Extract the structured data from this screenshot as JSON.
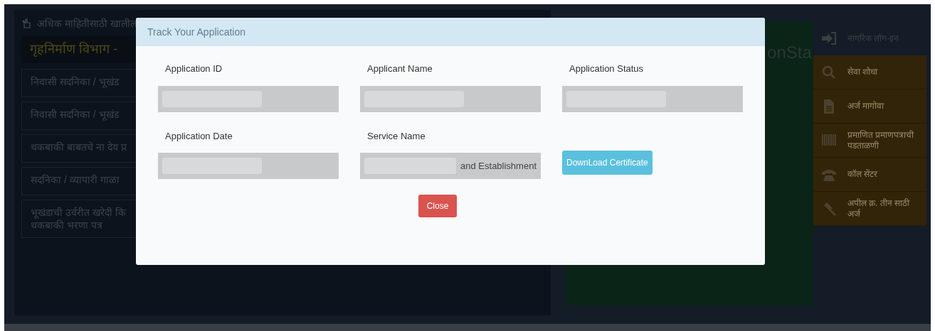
{
  "background": {
    "notice": "अधिक माहितीसाठी खालील",
    "department_heading": "गृहनिर्माण विभाग -",
    "services": [
      "निवासी सदनिका / भूखंड",
      "निवासी सदनिका / भूखंड",
      "थकबाकी बाबतचे ना देय प्र",
      "सदनिका / व्यापारी गाळा",
      "भूखंडाची उर्वरीत खरेदी कि\nथकबाकी भरणा पत्र"
    ],
    "logo_text": "onSta",
    "login": {
      "label": "नागरिक लॉग-इन"
    },
    "menu": [
      {
        "label": "सेवा शोधा",
        "kind": "search"
      },
      {
        "label": "अर्ज मागोवा",
        "kind": "document"
      },
      {
        "label": "प्रमाणित प्रमाणपत्राची पडताळणी",
        "kind": "barcode"
      },
      {
        "label": "कॉल सेंटर",
        "kind": "phone"
      },
      {
        "label": "अपील क्र. तीन साठी अर्ज",
        "kind": "gavel"
      }
    ]
  },
  "modal": {
    "title": "Track Your Application",
    "fields": [
      {
        "label": "Application ID",
        "redacted": true
      },
      {
        "label": "Applicant Name",
        "redacted": true
      },
      {
        "label": "Application Status",
        "redacted": true
      },
      {
        "label": "Application Date",
        "redacted": true
      },
      {
        "label": "Service Name",
        "redacted": true,
        "value": "and Establishment"
      }
    ],
    "download_button": "DownLoad Certificate",
    "close_button": "Close"
  }
}
